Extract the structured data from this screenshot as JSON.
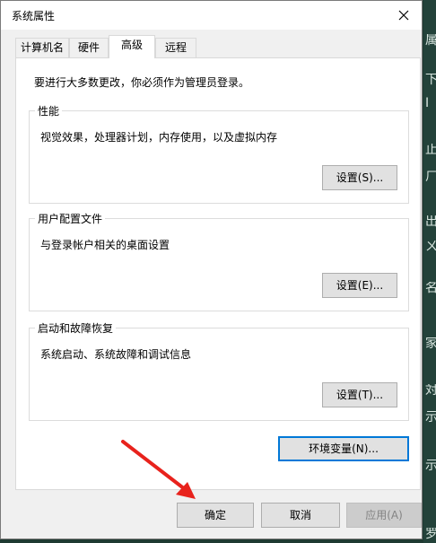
{
  "window": {
    "title": "系统属性"
  },
  "tabs": [
    {
      "label": "计算机名",
      "active": false
    },
    {
      "label": "硬件",
      "active": false
    },
    {
      "label": "高级",
      "active": true
    },
    {
      "label": "远程",
      "active": false
    }
  ],
  "advanced": {
    "intro": "要进行大多数更改，你必须作为管理员登录。",
    "performance": {
      "title": "性能",
      "description": "视觉效果，处理器计划，内存使用，以及虚拟内存",
      "button": "设置(S)..."
    },
    "user_profiles": {
      "title": "用户配置文件",
      "description": "与登录帐户相关的桌面设置",
      "button": "设置(E)..."
    },
    "startup_recovery": {
      "title": "启动和故障恢复",
      "description": "系统启动、系统故障和调试信息",
      "button": "设置(T)..."
    },
    "env_button": "环境变量(N)..."
  },
  "footer": {
    "ok": "确定",
    "cancel": "取消",
    "apply": "应用(A)"
  },
  "background_glyphs": [
    "属",
    "下",
    "I",
    "止",
    "ㄏ",
    "出",
    "ㄨ",
    "名",
    "家",
    "対",
    "示",
    "示",
    "罗"
  ],
  "colors": {
    "focus": "#0078d7",
    "annotation_arrow": "#e8221c"
  }
}
